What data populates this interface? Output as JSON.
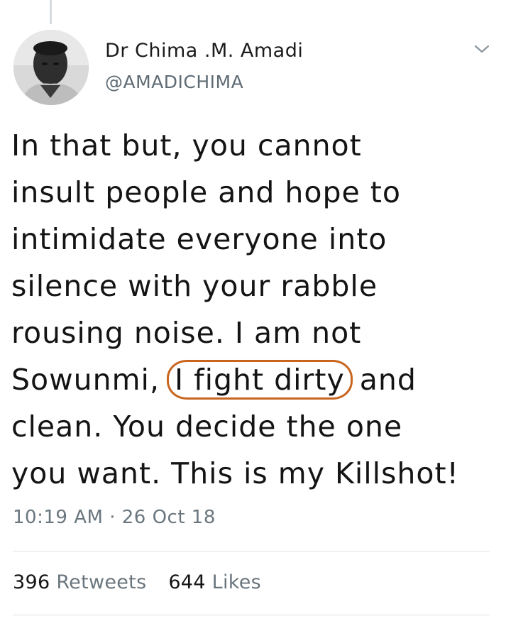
{
  "tweet": {
    "author_name": "Dr Chima .M. Amadi",
    "author_handle": "@AMADICHIMA",
    "text_lines": [
      "In that but, you cannot",
      "insult people and hope to",
      "intimidate everyone into",
      "silence with your rabble",
      "rousing noise. I am not"
    ],
    "line6_before": "Sowunmi,",
    "line6_circled": "I fight dirty",
    "line6_after": "and",
    "line7": "clean. You decide the one",
    "line8": "you want. This is my Killshot!",
    "time": "10:19 AM",
    "separator": "·",
    "date": "26 Oct 18",
    "retweets_count": "396",
    "retweets_label": "Retweets",
    "likes_count": "644",
    "likes_label": "Likes"
  },
  "icons": {
    "avatar": "author-photo",
    "menu": "chevron-down-icon"
  },
  "colors": {
    "annotation_circle": "#c8651e",
    "secondary_text": "#6a767e",
    "thread_line": "#d6dbdf"
  }
}
